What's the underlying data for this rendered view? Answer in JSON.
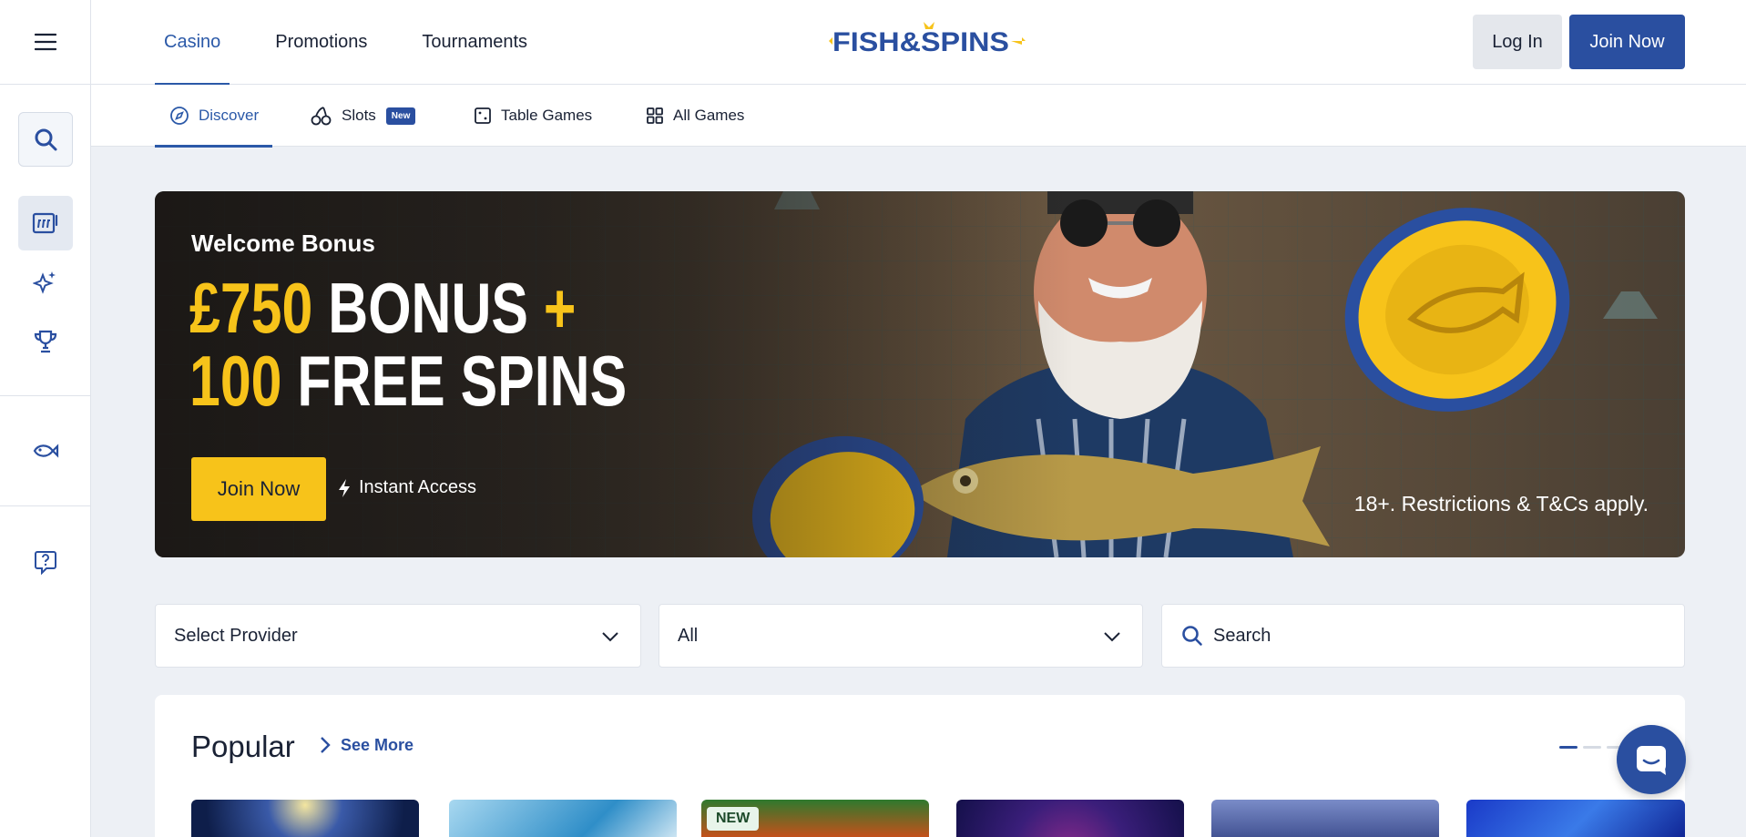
{
  "header": {
    "nav": [
      {
        "label": "Casino"
      },
      {
        "label": "Promotions"
      },
      {
        "label": "Tournaments"
      }
    ],
    "logo_text": "FISH&SPINS",
    "login_label": "Log In",
    "join_label": "Join Now"
  },
  "subnav": {
    "items": [
      {
        "label": "Discover",
        "icon": "compass-icon"
      },
      {
        "label": "Slots",
        "icon": "cherries-icon",
        "badge": "New"
      },
      {
        "label": "Table Games",
        "icon": "dice-icon"
      },
      {
        "label": "All Games",
        "icon": "grid-icon"
      }
    ]
  },
  "hero": {
    "welcome": "Welcome Bonus",
    "line1_yellow": "£750",
    "line1_white": " BONUS",
    "line1_plus": " +",
    "line2_yellow": "100",
    "line2_white": " FREE SPINS",
    "cta": "Join Now",
    "instant": "Instant Access",
    "terms": "18+. Restrictions & T&Cs apply."
  },
  "filters": {
    "provider": "Select Provider",
    "category": "All",
    "search_placeholder": "Search"
  },
  "popular": {
    "title": "Popular",
    "see_more": "See More",
    "new_tag": "NEW"
  },
  "colors": {
    "brand_blue": "#2a4fa0",
    "accent_yellow": "#f7c31a",
    "nav_active": "#2b59a8"
  }
}
